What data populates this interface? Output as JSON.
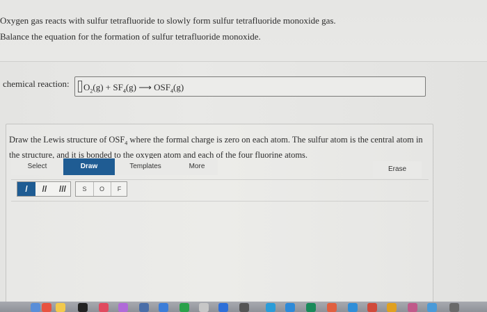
{
  "question": {
    "line1": "Oxygen gas reacts with sulfur tetrafluoride to slowly form sulfur tetrafluoride monoxide gas.",
    "line2": "Balance the equation for the formation of sulfur tetrafluoride monoxide."
  },
  "reaction": {
    "label": "chemical reaction:",
    "o2": "O",
    "o2_sub": "2",
    "o2_state": "(g) + SF",
    "sf4_sub": "4",
    "sf4_state": "(g)",
    "arrow": "⟶",
    "product": "OSF",
    "product_sub": "4",
    "product_state": "(g)"
  },
  "lewis": {
    "prompt_pre": "Draw the Lewis structure of OSF",
    "prompt_sub": "4",
    "prompt_post": " where the formal charge is zero on each atom. The sulfur atom is the central atom in the structure, and it is bonded to the oxygen atom and each of the four fluorine atoms."
  },
  "toolbar": {
    "select": "Select",
    "draw": "Draw",
    "templates": "Templates",
    "more": "More",
    "erase": "Erase"
  },
  "bonds": [
    "/",
    "//",
    "///"
  ],
  "atoms": [
    "S",
    "O",
    "F"
  ],
  "colors": {
    "accent": "#1f5c93"
  }
}
